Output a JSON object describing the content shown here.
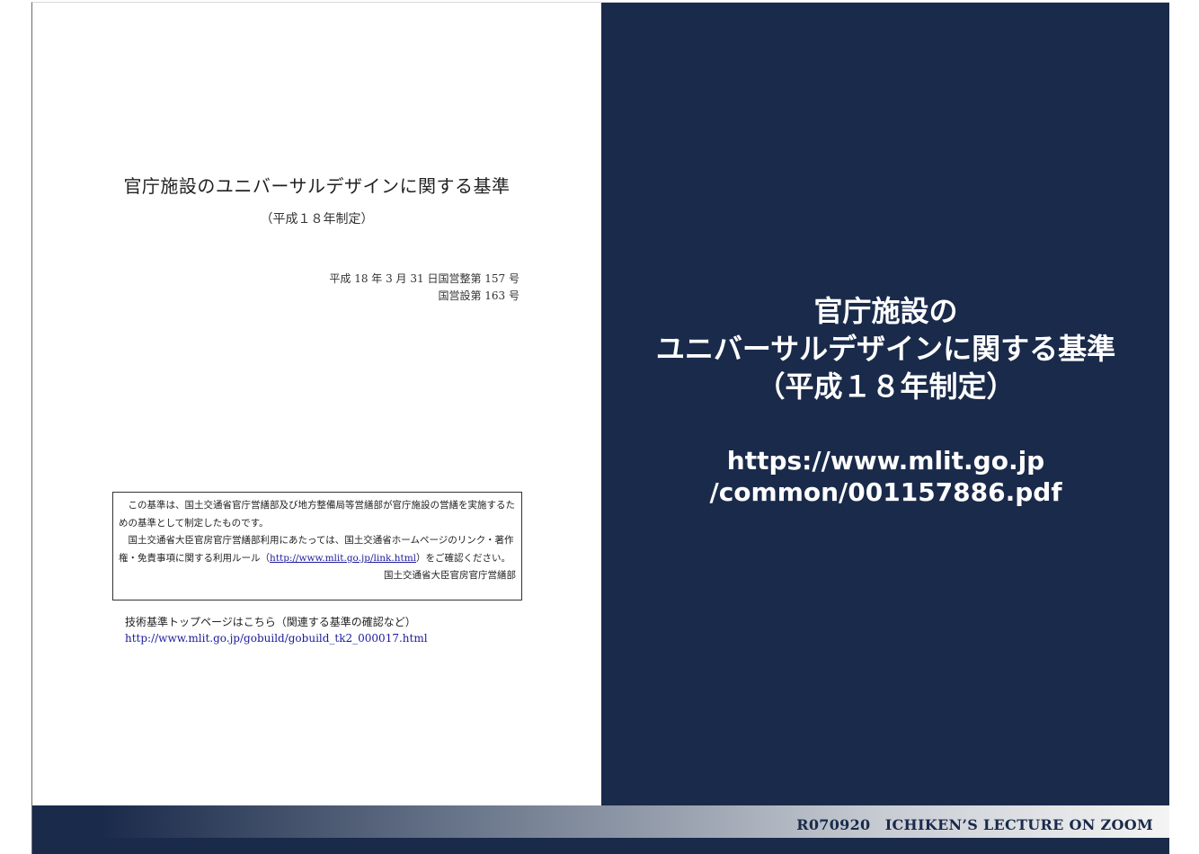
{
  "document": {
    "title": "官庁施設のユニバーサルデザインに関する基準",
    "subtitle": "（平成１８年制定）",
    "ref_line1": "平成 18 年 3 月 31 日国営整第 157 号",
    "ref_line2": "国営設第 163 号",
    "notice": {
      "para1": "この基準は、国土交通省官庁営繕部及び地方整備局等営繕部が官庁施設の営繕を実施するための基準として制定したものです。",
      "para2_before": "国土交通省大臣官房官庁営繕部利用にあたっては、国土交通省ホームページのリンク・著作権・免責事項に関する利用ルール（",
      "para2_link": "http://www.mlit.go.jp/link.html",
      "para2_after": "）をご確認ください。",
      "signature": "国土交通省大臣官房官庁営繕部"
    },
    "tech_label": "技術基準トップページはこちら（関連する基準の確認など）",
    "tech_url": "http://www.mlit.go.jp/gobuild/gobuild_tk2_000017.html"
  },
  "panel": {
    "title_line1": "官庁施設の",
    "title_line2": "ユニバーサルデザインに関する基準",
    "title_line3": "（平成１８年制定）",
    "url_line1": "https://www.mlit.go.jp",
    "url_line2": "/common/001157886.pdf"
  },
  "footer": {
    "text": "R070920　ICHIKEN’S LECTURE ON ZOOM"
  },
  "colors": {
    "panel_bg": "#1a2a4a",
    "link": "#1a1a9c"
  }
}
